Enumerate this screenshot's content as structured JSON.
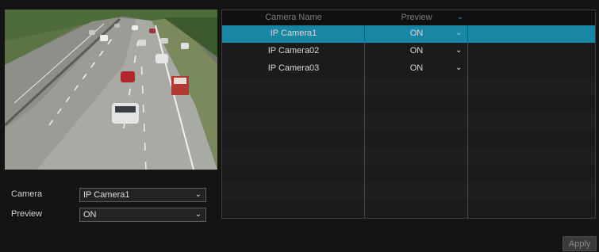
{
  "preview_panel": {
    "image_icon": "camera-feed-image"
  },
  "form": {
    "camera": {
      "label": "Camera",
      "value": "IP Camera1"
    },
    "preview": {
      "label": "Preview",
      "value": "ON"
    }
  },
  "table": {
    "headers": {
      "camera_name": "Camera Name",
      "preview": "Preview"
    },
    "rows": [
      {
        "camera_name": "IP Camera1",
        "preview": "ON",
        "selected": true
      },
      {
        "camera_name": "IP Camera02",
        "preview": "ON",
        "selected": false
      },
      {
        "camera_name": "IP Camera03",
        "preview": "ON",
        "selected": false
      }
    ]
  },
  "apply_label": "Apply",
  "colors": {
    "accent": "#1987a3",
    "background": "#141414"
  }
}
